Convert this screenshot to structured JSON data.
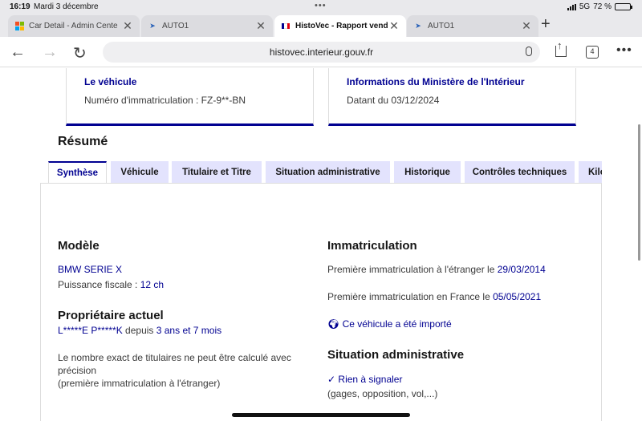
{
  "status": {
    "time": "16:19",
    "date": "Mardi 3 décembre",
    "network": "5G",
    "battery": "72 %",
    "battery_level": 0.72
  },
  "tabs": [
    {
      "label": "Car Detail - Admin Cente",
      "active": false
    },
    {
      "label": "AUTO1",
      "active": false
    },
    {
      "label": "HistoVec - Rapport vende",
      "active": true
    },
    {
      "label": "AUTO1",
      "active": false
    }
  ],
  "address": {
    "url": "histovec.interieur.gouv.fr",
    "tab_count": "4"
  },
  "cards": {
    "vehicle": {
      "title": "Le véhicule",
      "text": "Numéro d'immatriculation : FZ-9**-BN"
    },
    "ministry": {
      "title": "Informations du Ministère de l'Intérieur",
      "text": "Datant du 03/12/2024"
    }
  },
  "page_tabs": [
    "Synthèse",
    "Véhicule",
    "Titulaire et Titre",
    "Situation administrative",
    "Historique",
    "Contrôles techniques",
    "Kilo"
  ],
  "summary": {
    "title": "Résumé",
    "model": {
      "heading": "Modèle",
      "name": "BMW SERIE X",
      "power_label": "Puissance fiscale : ",
      "power_value": "12 ch"
    },
    "owner": {
      "heading": "Propriétaire actuel",
      "name": "L*****E P*****K",
      "since_label": " depuis ",
      "since_value": "3 ans et 7 mois",
      "note1": "Le nombre exact de titulaires ne peut être calculé avec",
      "note2": "précision",
      "note3": "(première immatriculation à l'étranger)"
    },
    "registration": {
      "heading": "Immatriculation",
      "foreign_label": "Première immatriculation à l'étranger le ",
      "foreign_date": "29/03/2014",
      "france_label": "Première immatriculation en France le ",
      "france_date": "05/05/2021",
      "imported": "Ce véhicule a été importé"
    },
    "admin": {
      "heading": "Situation administrative",
      "status": "Rien à signaler",
      "details": "(gages, opposition, vol,...)"
    }
  }
}
